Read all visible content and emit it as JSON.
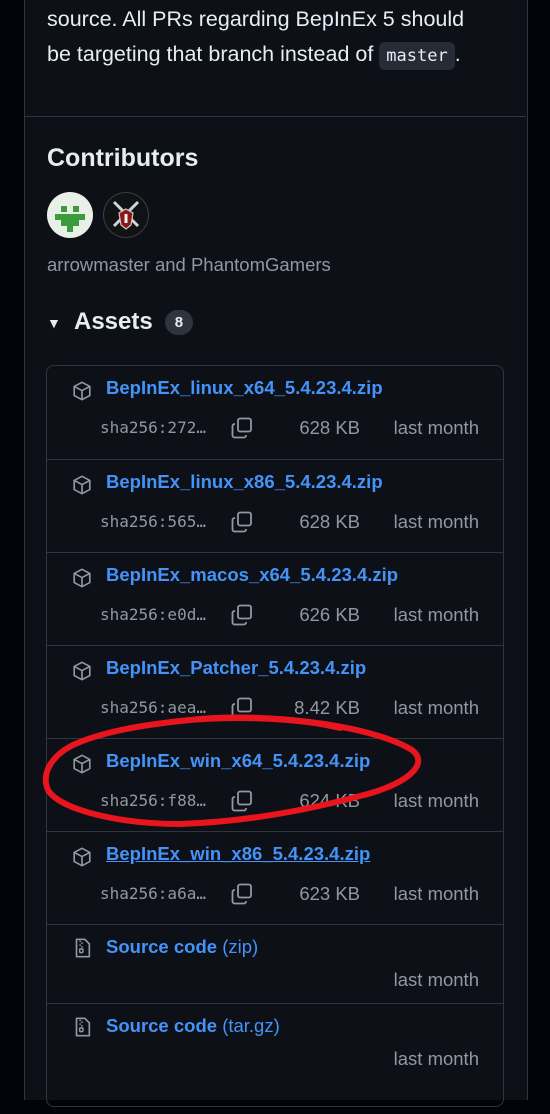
{
  "intro": {
    "line1": "source. All PRs regarding BepInEx 5 should",
    "line2_prefix": "be targeting that branch instead of",
    "code": "master",
    "line2_suffix": "."
  },
  "contributors": {
    "title": "Contributors",
    "names": "arrowmaster and PhantomGamers"
  },
  "assets": {
    "title": "Assets",
    "count": "8",
    "files": [
      {
        "name": "BepInEx_linux_x64_5.4.23.4.zip",
        "sha": "sha256:272…",
        "size": "628 KB",
        "date": "last month"
      },
      {
        "name": "BepInEx_linux_x86_5.4.23.4.zip",
        "sha": "sha256:565…",
        "size": "628 KB",
        "date": "last month"
      },
      {
        "name": "BepInEx_macos_x64_5.4.23.4.zip",
        "sha": "sha256:e0d…",
        "size": "626 KB",
        "date": "last month"
      },
      {
        "name": "BepInEx_Patcher_5.4.23.4.zip",
        "sha": "sha256:aea…",
        "size": "8.42 KB",
        "date": "last month"
      },
      {
        "name": "BepInEx_win_x64_5.4.23.4.zip",
        "sha": "sha256:f88…",
        "size": "624 KB",
        "date": "last month"
      },
      {
        "name": "BepInEx_win_x86_5.4.23.4.zip",
        "sha": "sha256:a6a…",
        "size": "623 KB",
        "date": "last month"
      }
    ],
    "source": [
      {
        "label": "Source code",
        "suffix": "(zip)",
        "date": "last month"
      },
      {
        "label": "Source code",
        "suffix": "(tar.gz)",
        "date": "last month"
      }
    ]
  },
  "colors": {
    "link": "#4493f8",
    "annotation": "#e8141e"
  }
}
